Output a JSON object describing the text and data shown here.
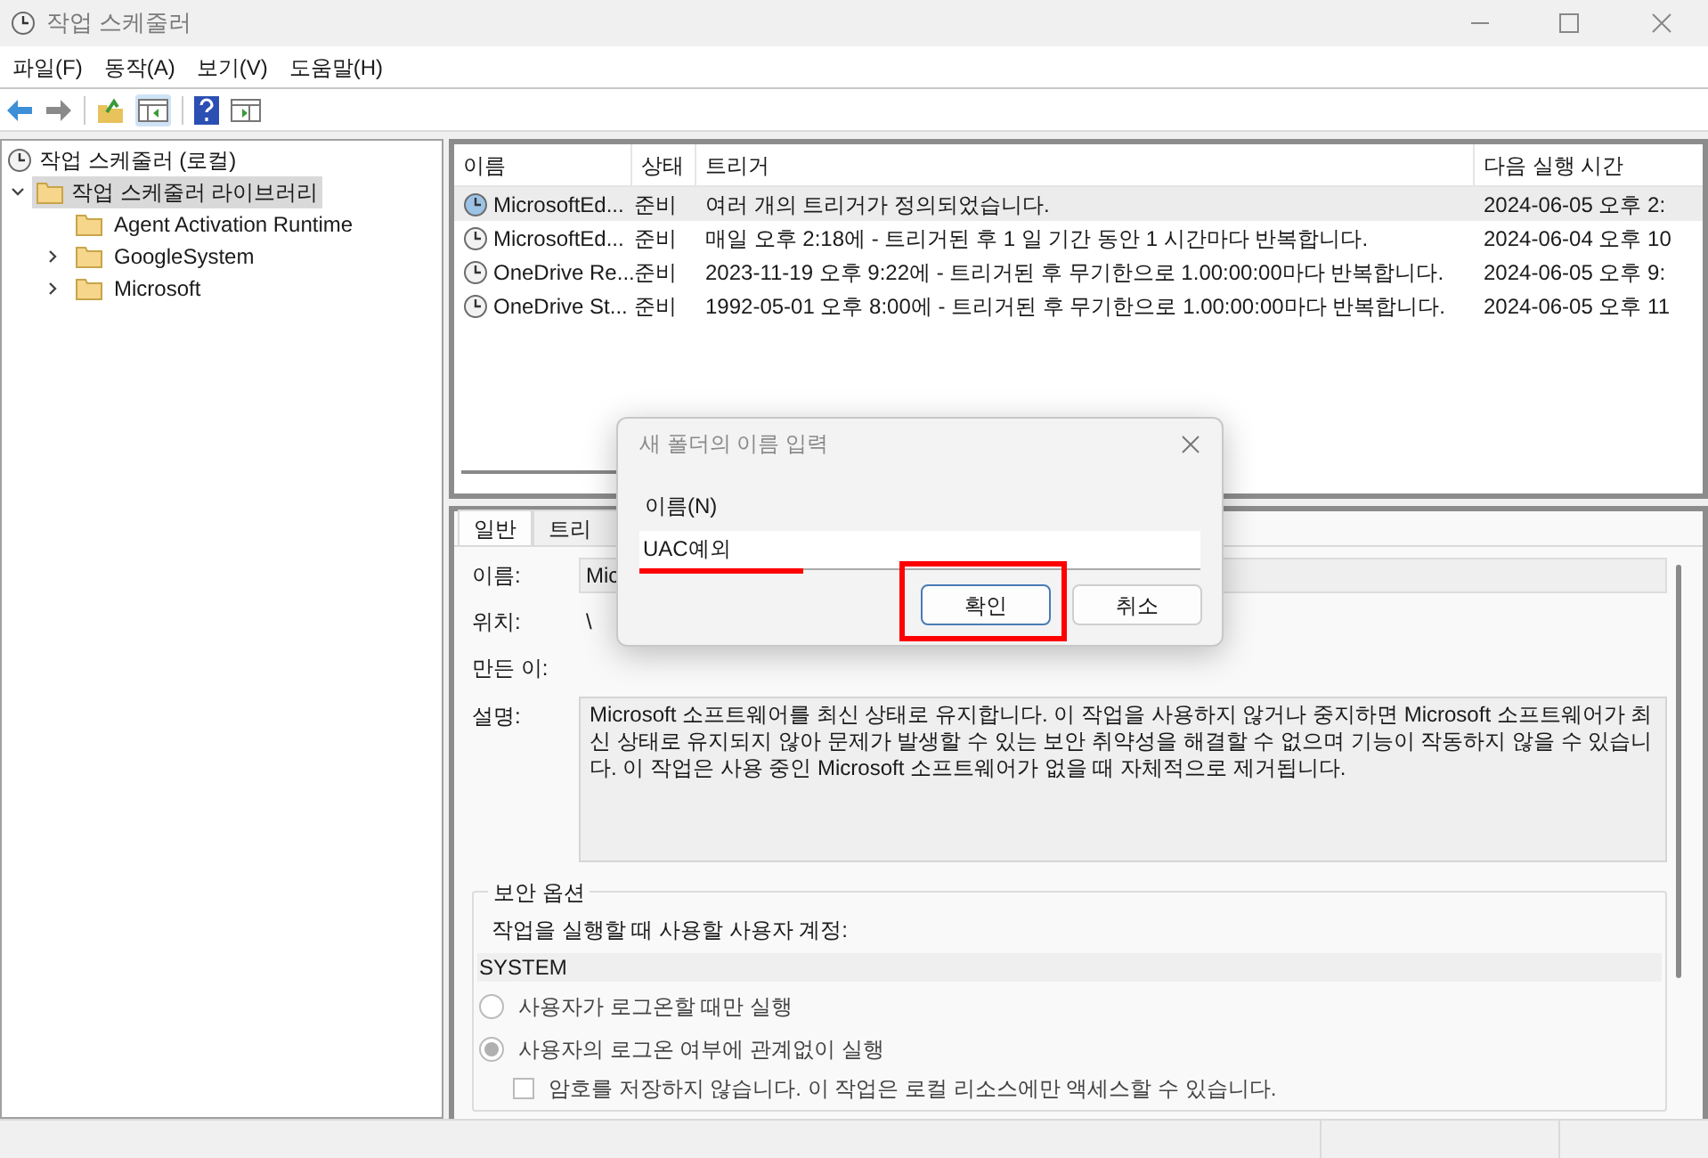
{
  "window": {
    "title": "작업 스케줄러"
  },
  "menu": [
    "파일(F)",
    "동작(A)",
    "보기(V)",
    "도움말(H)"
  ],
  "tree": {
    "label": "작업 스케줄러 (로컬)",
    "children": [
      {
        "label": "작업 스케줄러 라이브러리",
        "selected": true,
        "expanded": true,
        "children": [
          {
            "label": "Agent Activation Runtime",
            "selected": false,
            "expandable": false
          },
          {
            "label": "GoogleSystem",
            "selected": false,
            "expandable": true
          },
          {
            "label": "Microsoft",
            "selected": false,
            "expandable": true
          }
        ]
      }
    ]
  },
  "table": {
    "columns": [
      "이름",
      "상태",
      "트리거",
      "다음 실행 시간"
    ],
    "rows": [
      {
        "name": "MicrosoftEd...",
        "status": "준비",
        "trigger": "여러 개의 트리거가 정의되었습니다.",
        "next_run": "2024-06-05 오후 2:",
        "selected": true
      },
      {
        "name": "MicrosoftEd...",
        "status": "준비",
        "trigger": "매일 오후 2:18에 - 트리거된 후 1 일 기간 동안 1 시간마다 반복합니다.",
        "next_run": "2024-06-04 오후 10",
        "selected": false
      },
      {
        "name": "OneDrive Re...",
        "status": "준비",
        "trigger": "2023-11-19 오후 9:22에 - 트리거된 후 무기한으로 1.00:00:00마다 반복합니다.",
        "next_run": "2024-06-05 오후 9:",
        "selected": false
      },
      {
        "name": "OneDrive St...",
        "status": "준비",
        "trigger": "1992-05-01 오후 8:00에 - 트리거된 후 무기한으로 1.00:00:00마다 반복합니다.",
        "next_run": "2024-06-05 오후 11",
        "selected": false
      }
    ]
  },
  "details": {
    "tabs": [
      {
        "label": "일반",
        "selected": true
      },
      {
        "label": "트리",
        "selected": false
      }
    ],
    "fields": [
      {
        "label": "이름:",
        "value": "Mic"
      },
      {
        "label": "위치:",
        "value": "\\"
      },
      {
        "label": "만든 이:"
      }
    ],
    "description_label": "설명:",
    "description": "Microsoft 소프트웨어를 최신 상태로 유지합니다. 이 작업을 사용하지 않거나 중지하면 Microsoft 소프트웨어가 최신 상태로 유지되지 않아 문제가 발생할 수 있는 보안 취약성을 해결할 수 없으며 기능이 작동하지 않을 수 있습니다. 이 작업은 사용 중인 Microsoft 소프트웨어가 없을 때 자체적으로 제거됩니다.",
    "security": {
      "title": "보안 옵션",
      "account_label": "작업을 실행할 때 사용할 사용자 계정:",
      "account": "SYSTEM",
      "options": [
        {
          "label": "사용자가 로그온할 때만 실행",
          "selected": false
        },
        {
          "label": "사용자의 로그온 여부에 관계없이 실행",
          "selected": true
        }
      ],
      "no_password": {
        "label": "암호를 저장하지 않습니다. 이 작업은 로컬 리소스에만 액세스할 수 있습니다.",
        "checked": false
      }
    }
  },
  "dialog": {
    "title": "새 폴더의 이름 입력",
    "field_label": "이름(N)",
    "value": "UAC예외",
    "buttons": [
      {
        "label": "확인",
        "default": true,
        "highlighted": true
      },
      {
        "label": "취소",
        "default": false,
        "highlighted": false
      }
    ],
    "underlined": true
  }
}
